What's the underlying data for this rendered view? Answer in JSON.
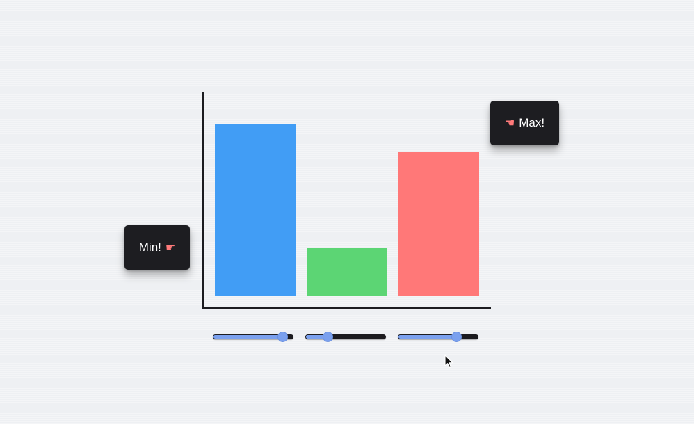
{
  "chart_data": {
    "type": "bar",
    "categories": [
      "",
      "",
      ""
    ],
    "values": [
      248,
      69,
      207
    ],
    "colors": [
      "#419df5",
      "#5cd574",
      "#ff7878"
    ],
    "ylim": [
      0,
      289
    ],
    "grid": false,
    "title": "",
    "xlabel": "",
    "ylabel": ""
  },
  "tooltips": {
    "min_label": "Min!",
    "max_label": "Max!",
    "min_icon": "pointing-hand-right-icon",
    "max_icon": "pointing-hand-left-icon",
    "hand_color": "#ff7a7a"
  },
  "sliders": [
    {
      "value": 0.86
    },
    {
      "value": 0.28
    },
    {
      "value": 0.72
    }
  ],
  "colors": {
    "background": "#eef0f3",
    "axis": "#1c1c20",
    "tooltip_bg": "#1d1d21",
    "slider_accent": "#7aa0ee"
  }
}
